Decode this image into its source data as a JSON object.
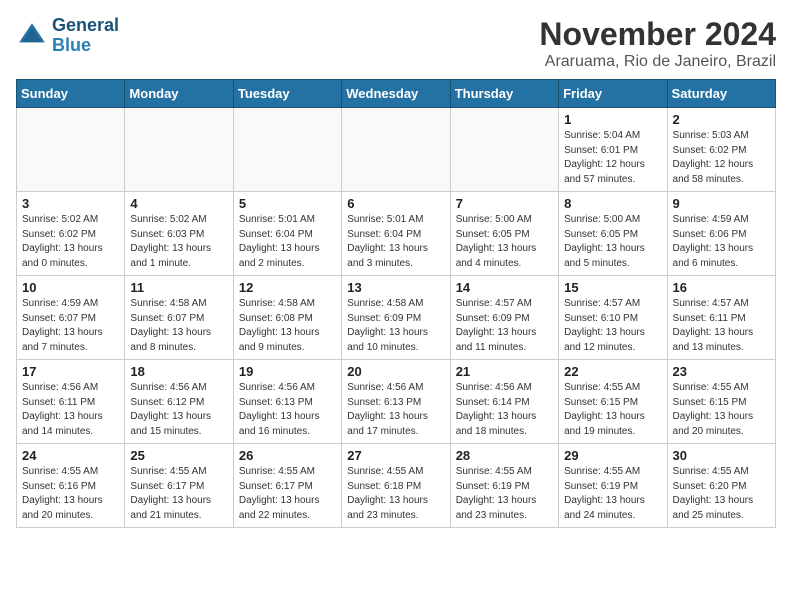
{
  "header": {
    "logo_line1": "General",
    "logo_line2": "Blue",
    "month_title": "November 2024",
    "location": "Araruama, Rio de Janeiro, Brazil"
  },
  "days_of_week": [
    "Sunday",
    "Monday",
    "Tuesday",
    "Wednesday",
    "Thursday",
    "Friday",
    "Saturday"
  ],
  "weeks": [
    [
      {
        "day": "",
        "info": ""
      },
      {
        "day": "",
        "info": ""
      },
      {
        "day": "",
        "info": ""
      },
      {
        "day": "",
        "info": ""
      },
      {
        "day": "",
        "info": ""
      },
      {
        "day": "1",
        "info": "Sunrise: 5:04 AM\nSunset: 6:01 PM\nDaylight: 12 hours and 57 minutes."
      },
      {
        "day": "2",
        "info": "Sunrise: 5:03 AM\nSunset: 6:02 PM\nDaylight: 12 hours and 58 minutes."
      }
    ],
    [
      {
        "day": "3",
        "info": "Sunrise: 5:02 AM\nSunset: 6:02 PM\nDaylight: 13 hours and 0 minutes."
      },
      {
        "day": "4",
        "info": "Sunrise: 5:02 AM\nSunset: 6:03 PM\nDaylight: 13 hours and 1 minute."
      },
      {
        "day": "5",
        "info": "Sunrise: 5:01 AM\nSunset: 6:04 PM\nDaylight: 13 hours and 2 minutes."
      },
      {
        "day": "6",
        "info": "Sunrise: 5:01 AM\nSunset: 6:04 PM\nDaylight: 13 hours and 3 minutes."
      },
      {
        "day": "7",
        "info": "Sunrise: 5:00 AM\nSunset: 6:05 PM\nDaylight: 13 hours and 4 minutes."
      },
      {
        "day": "8",
        "info": "Sunrise: 5:00 AM\nSunset: 6:05 PM\nDaylight: 13 hours and 5 minutes."
      },
      {
        "day": "9",
        "info": "Sunrise: 4:59 AM\nSunset: 6:06 PM\nDaylight: 13 hours and 6 minutes."
      }
    ],
    [
      {
        "day": "10",
        "info": "Sunrise: 4:59 AM\nSunset: 6:07 PM\nDaylight: 13 hours and 7 minutes."
      },
      {
        "day": "11",
        "info": "Sunrise: 4:58 AM\nSunset: 6:07 PM\nDaylight: 13 hours and 8 minutes."
      },
      {
        "day": "12",
        "info": "Sunrise: 4:58 AM\nSunset: 6:08 PM\nDaylight: 13 hours and 9 minutes."
      },
      {
        "day": "13",
        "info": "Sunrise: 4:58 AM\nSunset: 6:09 PM\nDaylight: 13 hours and 10 minutes."
      },
      {
        "day": "14",
        "info": "Sunrise: 4:57 AM\nSunset: 6:09 PM\nDaylight: 13 hours and 11 minutes."
      },
      {
        "day": "15",
        "info": "Sunrise: 4:57 AM\nSunset: 6:10 PM\nDaylight: 13 hours and 12 minutes."
      },
      {
        "day": "16",
        "info": "Sunrise: 4:57 AM\nSunset: 6:11 PM\nDaylight: 13 hours and 13 minutes."
      }
    ],
    [
      {
        "day": "17",
        "info": "Sunrise: 4:56 AM\nSunset: 6:11 PM\nDaylight: 13 hours and 14 minutes."
      },
      {
        "day": "18",
        "info": "Sunrise: 4:56 AM\nSunset: 6:12 PM\nDaylight: 13 hours and 15 minutes."
      },
      {
        "day": "19",
        "info": "Sunrise: 4:56 AM\nSunset: 6:13 PM\nDaylight: 13 hours and 16 minutes."
      },
      {
        "day": "20",
        "info": "Sunrise: 4:56 AM\nSunset: 6:13 PM\nDaylight: 13 hours and 17 minutes."
      },
      {
        "day": "21",
        "info": "Sunrise: 4:56 AM\nSunset: 6:14 PM\nDaylight: 13 hours and 18 minutes."
      },
      {
        "day": "22",
        "info": "Sunrise: 4:55 AM\nSunset: 6:15 PM\nDaylight: 13 hours and 19 minutes."
      },
      {
        "day": "23",
        "info": "Sunrise: 4:55 AM\nSunset: 6:15 PM\nDaylight: 13 hours and 20 minutes."
      }
    ],
    [
      {
        "day": "24",
        "info": "Sunrise: 4:55 AM\nSunset: 6:16 PM\nDaylight: 13 hours and 20 minutes."
      },
      {
        "day": "25",
        "info": "Sunrise: 4:55 AM\nSunset: 6:17 PM\nDaylight: 13 hours and 21 minutes."
      },
      {
        "day": "26",
        "info": "Sunrise: 4:55 AM\nSunset: 6:17 PM\nDaylight: 13 hours and 22 minutes."
      },
      {
        "day": "27",
        "info": "Sunrise: 4:55 AM\nSunset: 6:18 PM\nDaylight: 13 hours and 23 minutes."
      },
      {
        "day": "28",
        "info": "Sunrise: 4:55 AM\nSunset: 6:19 PM\nDaylight: 13 hours and 23 minutes."
      },
      {
        "day": "29",
        "info": "Sunrise: 4:55 AM\nSunset: 6:19 PM\nDaylight: 13 hours and 24 minutes."
      },
      {
        "day": "30",
        "info": "Sunrise: 4:55 AM\nSunset: 6:20 PM\nDaylight: 13 hours and 25 minutes."
      }
    ]
  ]
}
